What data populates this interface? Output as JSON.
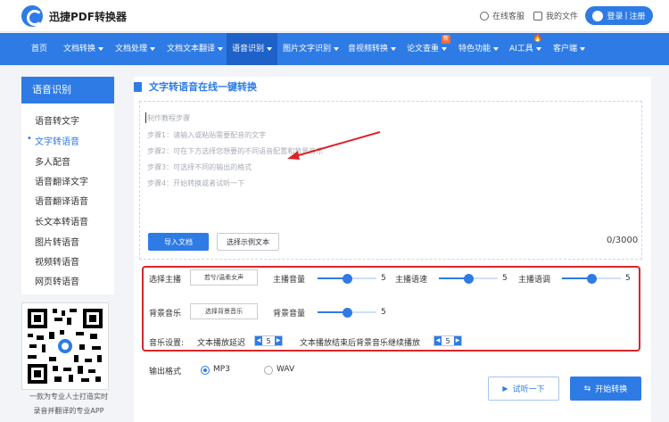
{
  "app": {
    "title": "迅捷PDF转换器"
  },
  "header": {
    "service": "在线客服",
    "my_files": "我的文件",
    "login": "登录",
    "register": "注册",
    "login_sep": "|"
  },
  "nav": {
    "items": [
      {
        "label": "首页",
        "has_arrow": false
      },
      {
        "label": "文档转换",
        "has_arrow": true
      },
      {
        "label": "文档处理",
        "has_arrow": true
      },
      {
        "label": "文档文本翻译",
        "has_arrow": true
      },
      {
        "label": "语音识别",
        "has_arrow": true,
        "active": true
      },
      {
        "label": "图片文字识别",
        "has_arrow": true
      },
      {
        "label": "音视频转换",
        "has_arrow": true
      },
      {
        "label": "论文查重",
        "has_arrow": true
      },
      {
        "label": "特色功能",
        "has_arrow": true
      },
      {
        "label": "AI工具",
        "has_arrow": true
      },
      {
        "label": "客户端",
        "has_arrow": true
      }
    ],
    "badge_new": "新",
    "fire_icon": "🔥"
  },
  "sidebar": {
    "title": "语音识别",
    "items": [
      "语音转文字",
      "文字转语音",
      "多人配音",
      "语音翻译文字",
      "语音翻译语音",
      "长文本转语音",
      "图片转语音",
      "视频转语音",
      "网页转语音"
    ],
    "active_index": 1
  },
  "qr": {
    "tagline_1": "一款为专业人士打造实时",
    "tagline_2": "录音并翻译的专业APP"
  },
  "main": {
    "title": "文字转语音在线一键转换",
    "placeholder_lines": [
      "制作教程步骤",
      "步骤1：请输入或粘贴需要配音的文字",
      "步骤2：可在下方选择您想要的不同语音配置和背景音乐",
      "步骤3：可选择不同的输出的格式",
      "步骤4：开始转换或者试听一下"
    ],
    "import_button": "导入文档",
    "sample_button": "选择示例文本",
    "counter": "0/3000"
  },
  "settings": {
    "anchor_label": "选择主播",
    "anchor_value": "若兮/温柔女声",
    "volume_label": "主播音量",
    "volume_value": "5",
    "speed_label": "主播语速",
    "speed_value": "5",
    "pitch_label": "主播语调",
    "pitch_value": "5",
    "bgm_label": "背景音乐",
    "bgm_button": "选择背景音乐",
    "bgm_volume_label": "背景音量",
    "bgm_volume_value": "5",
    "slider_fraction": 0.5,
    "audio_settings_label": "音乐设置:",
    "delay_label": "文本播放延迟",
    "delay_value": "5",
    "continue_label": "文本播放结束后背景音乐继续播放",
    "continue_value": "5"
  },
  "output": {
    "label": "输出格式",
    "options": [
      "MP3",
      "WAV"
    ],
    "selected": "MP3"
  },
  "actions": {
    "preview": "试听一下",
    "convert": "开始转换",
    "preview_icon": "▶",
    "convert_icon": "⇆"
  },
  "colors": {
    "accent": "#2e7be5",
    "highlight_box": "#d9262b"
  }
}
